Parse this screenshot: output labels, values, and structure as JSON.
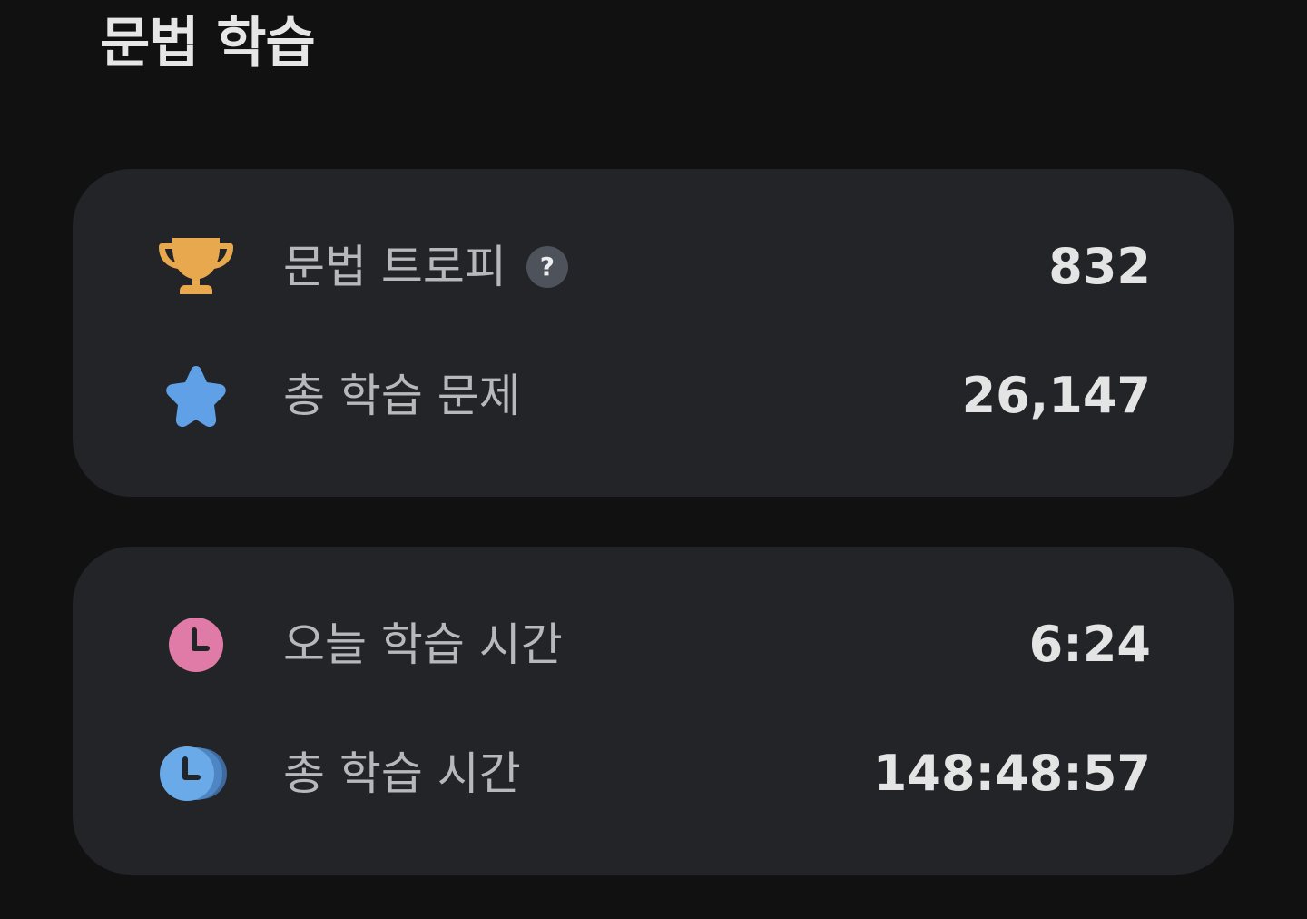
{
  "header": {
    "title": "문법 학습"
  },
  "stats_card": {
    "rows": [
      {
        "icon": "trophy-icon",
        "label": "문법 트로피",
        "help": "?",
        "value": "832"
      },
      {
        "icon": "star-icon",
        "label": "총 학습 문제",
        "value": "26,147"
      }
    ]
  },
  "time_card": {
    "rows": [
      {
        "icon": "clock-icon",
        "label": "오늘 학습 시간",
        "value": "6:24"
      },
      {
        "icon": "stacked-clock-icon",
        "label": "총 학습 시간",
        "value": "148:48:57"
      }
    ]
  },
  "colors": {
    "background": "#111111",
    "card": "#222428",
    "trophy": "#E8A94E",
    "star": "#5FA0E6",
    "clock_today": "#E07BA8",
    "clock_total": "#6AAAE8"
  }
}
